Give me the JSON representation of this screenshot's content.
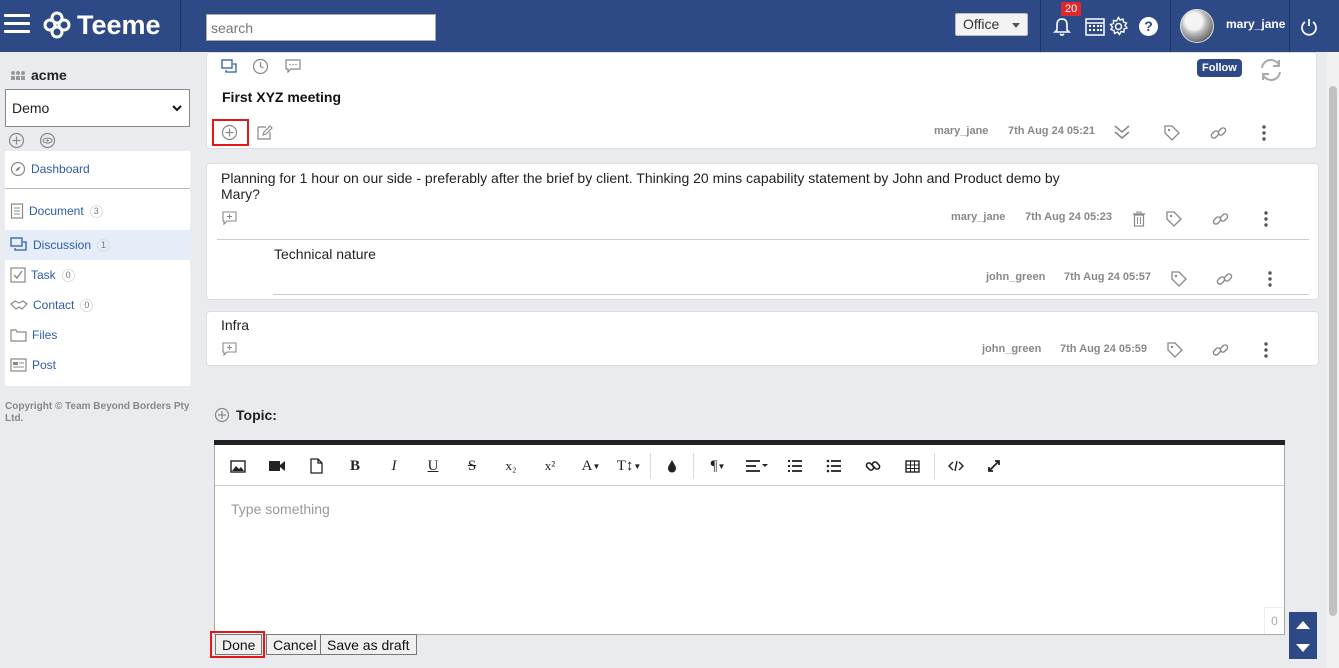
{
  "app": {
    "name": "Teeme"
  },
  "header": {
    "search_placeholder": "search",
    "office_label": "Office",
    "notification_count": "20",
    "help_label": "?",
    "username": "mary_jane"
  },
  "sidebar": {
    "org_name": "acme",
    "workspace_selected": "Demo",
    "items": [
      {
        "label": "Dashboard",
        "icon": "compass-icon"
      },
      {
        "label": "Document",
        "count": "3",
        "icon": "document-icon"
      },
      {
        "label": "Discussion",
        "count": "1",
        "icon": "discussion-icon"
      },
      {
        "label": "Task",
        "count": "0",
        "icon": "checkbox-icon"
      },
      {
        "label": "Contact",
        "count": "0",
        "icon": "handshake-icon"
      },
      {
        "label": "Files",
        "icon": "folder-icon"
      },
      {
        "label": "Post",
        "icon": "post-icon"
      }
    ],
    "copyright": "Copyright © Team Beyond Borders Pty Ltd."
  },
  "discussion": {
    "follow_label": "Follow",
    "title": "First XYZ meeting",
    "author": "mary_jane",
    "date": "7th Aug 24 05:21"
  },
  "comments": [
    {
      "text": "Planning for 1 hour on our side - preferably after the brief by client. Thinking 20 mins capability statement by John and Product demo by Mary?",
      "author": "mary_jane",
      "date": "7th Aug 24 05:23",
      "replies": [
        {
          "text": "Technical nature",
          "author": "john_green",
          "date": "7th Aug 24 05:57"
        }
      ]
    },
    {
      "text": "Infra",
      "author": "john_green",
      "date": "7th Aug 24 05:59"
    }
  ],
  "editor": {
    "topic_label": "Topic:",
    "placeholder": "Type something",
    "char_count": "0",
    "toolbar": [
      "image-icon",
      "video-icon",
      "file-icon",
      "bold-icon",
      "italic-icon",
      "underline-icon",
      "strikethrough-icon",
      "subscript-icon",
      "superscript-icon",
      "font-color-icon",
      "font-size-icon",
      "ink-drop-icon",
      "paragraph-icon",
      "align-icon",
      "ordered-list-icon",
      "unordered-list-icon",
      "link-icon",
      "table-icon",
      "code-view-icon",
      "fullscreen-icon"
    ],
    "toolbar_text": {
      "bold": "B",
      "italic": "I",
      "underline": "U",
      "strike": "S",
      "sub": "x₂",
      "sup": "x²",
      "fontcolor": "A",
      "fontsize": "T↕",
      "para": "¶"
    }
  },
  "buttons": {
    "done": "Done",
    "cancel": "Cancel",
    "draft": "Save as draft"
  },
  "colors": {
    "header_bg": "#2d4a86",
    "link": "#2d5ca6",
    "highlight": "#e01818"
  }
}
